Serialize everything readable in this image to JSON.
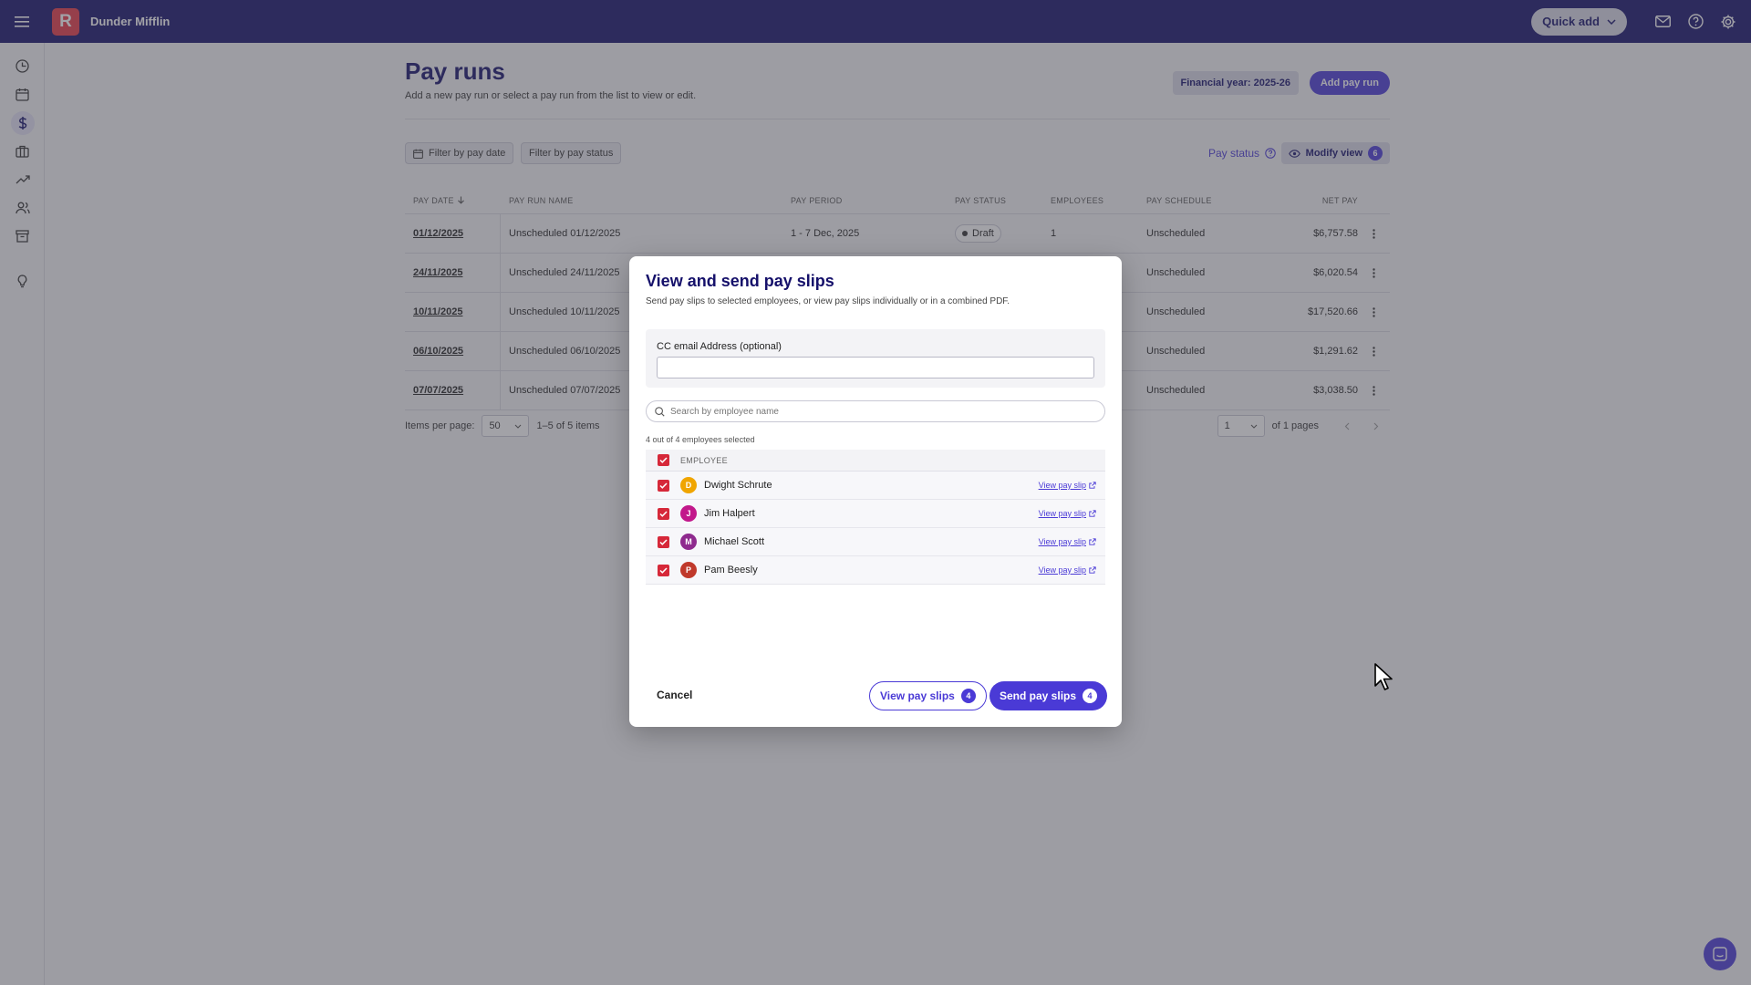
{
  "app": {
    "company": "Dunder Mifflin",
    "logo_letter": "R",
    "quick_add": "Quick add"
  },
  "page": {
    "title": "Pay runs",
    "subtitle": "Add a new pay run or select a pay run from the list to view or edit.",
    "financial_year": "Financial year: 2025-26",
    "add_pay_run": "Add pay run"
  },
  "filters": {
    "by_date": "Filter by pay date",
    "by_status": "Filter by pay status",
    "pay_status": "Pay status",
    "modify_view": "Modify view",
    "modify_view_count": "6"
  },
  "table": {
    "headers": {
      "pay_date": "PAY DATE",
      "pay_run_name": "PAY RUN NAME",
      "pay_period": "PAY PERIOD",
      "pay_status": "PAY STATUS",
      "employees": "EMPLOYEES",
      "pay_schedule": "PAY SCHEDULE",
      "net_pay": "NET PAY"
    },
    "rows": [
      {
        "date": "01/12/2025",
        "name": "Unscheduled 01/12/2025",
        "period": "1 - 7 Dec, 2025",
        "status": "Draft",
        "employees": "1",
        "schedule": "Unscheduled",
        "net": "$6,757.58"
      },
      {
        "date": "24/11/2025",
        "name": "Unscheduled 24/11/2025",
        "period": "",
        "status": "",
        "employees": "",
        "schedule": "Unscheduled",
        "net": "$6,020.54"
      },
      {
        "date": "10/11/2025",
        "name": "Unscheduled 10/11/2025",
        "period": "",
        "status": "",
        "employees": "",
        "schedule": "Unscheduled",
        "net": "$17,520.66"
      },
      {
        "date": "06/10/2025",
        "name": "Unscheduled 06/10/2025",
        "period": "",
        "status": "",
        "employees": "",
        "schedule": "Unscheduled",
        "net": "$1,291.62"
      },
      {
        "date": "07/07/2025",
        "name": "Unscheduled 07/07/2025",
        "period": "",
        "status": "",
        "employees": "",
        "schedule": "Unscheduled",
        "net": "$3,038.50"
      }
    ]
  },
  "pager": {
    "items_per_page_label": "Items per page:",
    "items_per_page": "50",
    "range": "1–5 of 5 items",
    "page": "1",
    "of_pages": "of 1 pages"
  },
  "modal": {
    "title": "View and send pay slips",
    "subtitle": "Send pay slips to selected employees, or view pay slips individually or in a combined PDF.",
    "cc_label": "CC email Address (optional)",
    "cc_value": "",
    "search_placeholder": "Search by employee name",
    "selected_count": "4 out of 4 employees selected",
    "employee_header": "EMPLOYEE",
    "view_slip_label": "View pay slip",
    "employees": [
      {
        "initial": "D",
        "name": "Dwight Schrute",
        "color": "#f0a500"
      },
      {
        "initial": "J",
        "name": "Jim Halpert",
        "color": "#c2188b"
      },
      {
        "initial": "M",
        "name": "Michael Scott",
        "color": "#8e2a8e"
      },
      {
        "initial": "P",
        "name": "Pam Beesly",
        "color": "#c0392b"
      }
    ],
    "cancel": "Cancel",
    "view_pay_slips": "View pay slips",
    "view_count": "4",
    "send_pay_slips": "Send pay slips",
    "send_count": "4"
  },
  "colors": {
    "topbar": "#15106a",
    "accent": "#4a3ad6",
    "checkbox": "#d62839"
  }
}
